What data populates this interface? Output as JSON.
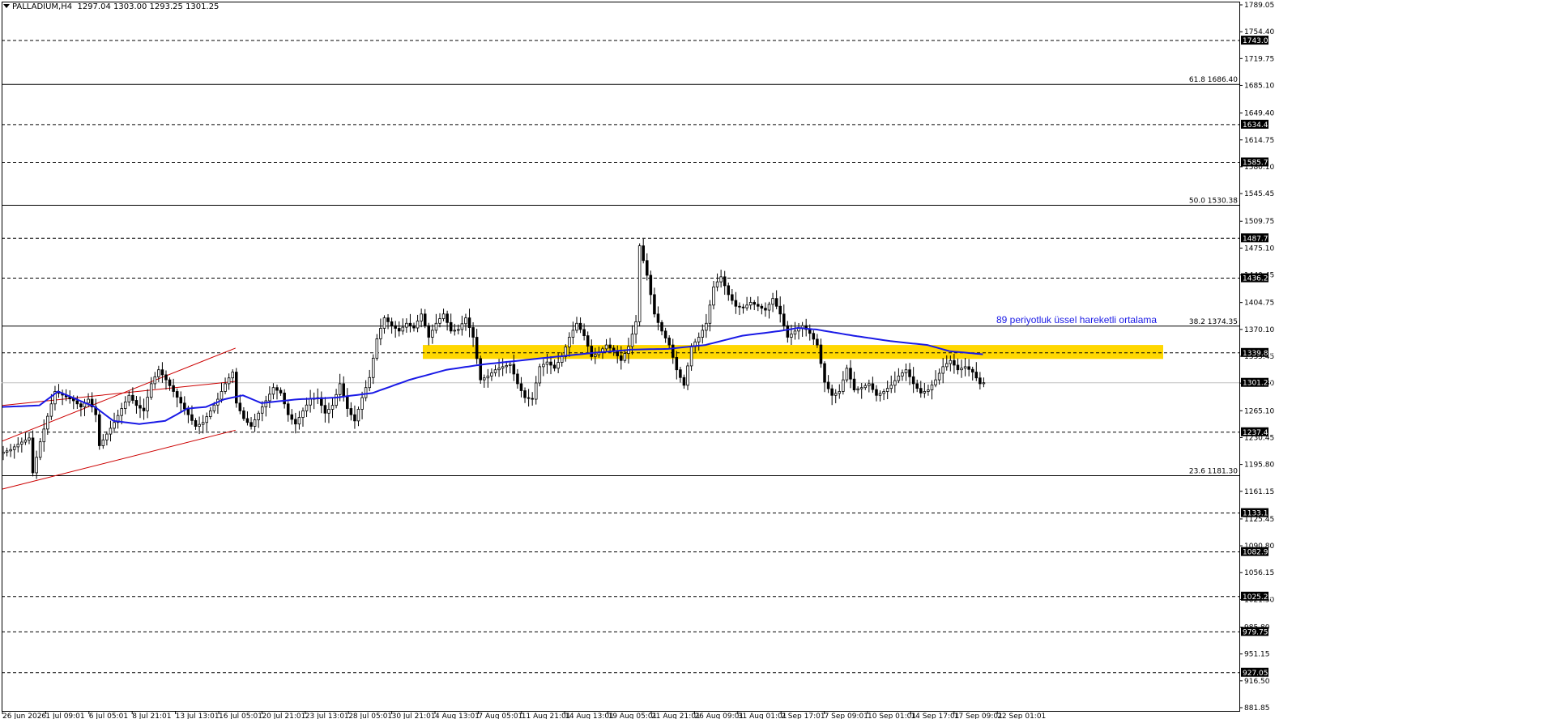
{
  "header": {
    "symbol": "PALLADIUM,H4",
    "ohlc": "1297.04 1303.00 1293.25 1301.25"
  },
  "annotation": "89 periyotluk üssel hareketli ortalama",
  "colors": {
    "candle": "#000000",
    "ema": "#1a1ae6",
    "channel": "#cc0000",
    "zone": "#ffd700",
    "grid": "#000000"
  },
  "chart_data": {
    "type": "candlestick",
    "symbol": "PALLADIUM",
    "timeframe": "H4",
    "ylim": [
      881.85,
      1789.05
    ],
    "y_ticks": [
      "1789.05",
      "1754.40",
      "1719.75",
      "1685.10",
      "1649.40",
      "1614.75",
      "1580.10",
      "1545.45",
      "1509.75",
      "1475.10",
      "1440.45",
      "1404.75",
      "1370.10",
      "1335.45",
      "1300.80",
      "1265.10",
      "1230.45",
      "1195.80",
      "1161.15",
      "1125.45",
      "1090.80",
      "1056.15",
      "1021.50",
      "985.80",
      "951.15",
      "916.50",
      "881.85"
    ],
    "x_ticks": [
      "26 Jun 2026",
      "1 Jul 09:01",
      "6 Jul 05:01",
      "8 Jul 21:01",
      "13 Jul 13:01",
      "16 Jul 05:01",
      "20 Jul 21:01",
      "23 Jul 13:01",
      "28 Jul 05:01",
      "30 Jul 21:01",
      "4 Aug 13:01",
      "7 Aug 05:01",
      "11 Aug 21:01",
      "14 Aug 13:01",
      "19 Aug 05:01",
      "21 Aug 21:01",
      "26 Aug 09:01",
      "31 Aug 01:01",
      "2 Sep 17:01",
      "7 Sep 09:01",
      "10 Sep 01:01",
      "14 Sep 17:01",
      "17 Sep 09:01",
      "22 Sep 01:01"
    ],
    "dashed_levels": [
      {
        "value": 1743.0,
        "label": "1743.00"
      },
      {
        "value": 1634.45,
        "label": "1634.45"
      },
      {
        "value": 1585.75,
        "label": "1585.75"
      },
      {
        "value": 1487.75,
        "label": "1487.75"
      },
      {
        "value": 1436.25,
        "label": "1436.25"
      },
      {
        "value": 1339.85,
        "label": "1339.85"
      },
      {
        "value": 1237.45,
        "label": "1237.45"
      },
      {
        "value": 1133.1,
        "label": "1133.10"
      },
      {
        "value": 1082.9,
        "label": "1082.90"
      },
      {
        "value": 1025.25,
        "label": "1025.25"
      },
      {
        "value": 979.75,
        "label": "979.75"
      },
      {
        "value": 927.05,
        "label": "927.05"
      }
    ],
    "fib_levels": [
      {
        "value": 1686.4,
        "label": "61.8 1686.40"
      },
      {
        "value": 1530.38,
        "label": "50.0 1530.38"
      },
      {
        "value": 1374.35,
        "label": "38.2 1374.35"
      },
      {
        "value": 1181.3,
        "label": "23.6 1181.30"
      }
    ],
    "current_price": {
      "value": 1301.25,
      "label": "1301.25"
    },
    "zone": {
      "top": 1350,
      "bottom": 1332
    },
    "price_path": [
      [
        0,
        1210
      ],
      [
        3,
        1215
      ],
      [
        5,
        1222
      ],
      [
        8,
        1230
      ],
      [
        9,
        1185
      ],
      [
        11,
        1225
      ],
      [
        13,
        1258
      ],
      [
        15,
        1290
      ],
      [
        18,
        1283
      ],
      [
        20,
        1278
      ],
      [
        22,
        1270
      ],
      [
        24,
        1280
      ],
      [
        26,
        1260
      ],
      [
        27,
        1220
      ],
      [
        29,
        1235
      ],
      [
        31,
        1250
      ],
      [
        33,
        1268
      ],
      [
        35,
        1285
      ],
      [
        37,
        1272
      ],
      [
        39,
        1265
      ],
      [
        41,
        1300
      ],
      [
        43,
        1318
      ],
      [
        45,
        1305
      ],
      [
        47,
        1290
      ],
      [
        49,
        1275
      ],
      [
        51,
        1260
      ],
      [
        53,
        1245
      ],
      [
        55,
        1250
      ],
      [
        57,
        1265
      ],
      [
        59,
        1280
      ],
      [
        61,
        1300
      ],
      [
        63,
        1315
      ],
      [
        64,
        1275
      ],
      [
        66,
        1255
      ],
      [
        68,
        1245
      ],
      [
        70,
        1262
      ],
      [
        72,
        1278
      ],
      [
        74,
        1295
      ],
      [
        76,
        1288
      ],
      [
        78,
        1260
      ],
      [
        80,
        1248
      ],
      [
        82,
        1265
      ],
      [
        84,
        1280
      ],
      [
        86,
        1282
      ],
      [
        88,
        1262
      ],
      [
        90,
        1272
      ],
      [
        92,
        1300
      ],
      [
        94,
        1268
      ],
      [
        96,
        1252
      ],
      [
        98,
        1282
      ],
      [
        100,
        1308
      ],
      [
        102,
        1358
      ],
      [
        104,
        1385
      ],
      [
        106,
        1375
      ],
      [
        108,
        1368
      ],
      [
        110,
        1378
      ],
      [
        112,
        1372
      ],
      [
        114,
        1390
      ],
      [
        116,
        1360
      ],
      [
        118,
        1378
      ],
      [
        120,
        1390
      ],
      [
        122,
        1368
      ],
      [
        124,
        1370
      ],
      [
        126,
        1385
      ],
      [
        128,
        1360
      ],
      [
        130,
        1305
      ],
      [
        132,
        1310
      ],
      [
        134,
        1318
      ],
      [
        136,
        1322
      ],
      [
        138,
        1325
      ],
      [
        140,
        1300
      ],
      [
        142,
        1282
      ],
      [
        144,
        1280
      ],
      [
        146,
        1322
      ],
      [
        148,
        1328
      ],
      [
        150,
        1320
      ],
      [
        152,
        1335
      ],
      [
        154,
        1360
      ],
      [
        156,
        1378
      ],
      [
        158,
        1362
      ],
      [
        160,
        1335
      ],
      [
        162,
        1340
      ],
      [
        164,
        1350
      ],
      [
        166,
        1342
      ],
      [
        168,
        1330
      ],
      [
        170,
        1348
      ],
      [
        172,
        1380
      ],
      [
        173,
        1478
      ],
      [
        175,
        1440
      ],
      [
        177,
        1390
      ],
      [
        179,
        1368
      ],
      [
        181,
        1350
      ],
      [
        183,
        1318
      ],
      [
        185,
        1298
      ],
      [
        187,
        1348
      ],
      [
        189,
        1360
      ],
      [
        191,
        1378
      ],
      [
        193,
        1425
      ],
      [
        195,
        1438
      ],
      [
        197,
        1415
      ],
      [
        199,
        1400
      ],
      [
        201,
        1398
      ],
      [
        203,
        1405
      ],
      [
        205,
        1400
      ],
      [
        207,
        1395
      ],
      [
        209,
        1410
      ],
      [
        211,
        1390
      ],
      [
        213,
        1360
      ],
      [
        215,
        1368
      ],
      [
        217,
        1375
      ],
      [
        219,
        1365
      ],
      [
        221,
        1350
      ],
      [
        223,
        1302
      ],
      [
        225,
        1285
      ],
      [
        227,
        1290
      ],
      [
        229,
        1320
      ],
      [
        231,
        1292
      ],
      [
        233,
        1295
      ],
      [
        235,
        1300
      ],
      [
        237,
        1285
      ],
      [
        239,
        1290
      ],
      [
        241,
        1298
      ],
      [
        243,
        1310
      ],
      [
        245,
        1318
      ],
      [
        247,
        1300
      ],
      [
        249,
        1288
      ],
      [
        251,
        1292
      ],
      [
        253,
        1305
      ],
      [
        255,
        1322
      ],
      [
        257,
        1330
      ],
      [
        259,
        1318
      ],
      [
        261,
        1322
      ],
      [
        263,
        1315
      ],
      [
        265,
        1300
      ],
      [
        266,
        1301.25
      ]
    ],
    "ema_path": [
      [
        0,
        1270
      ],
      [
        10,
        1272
      ],
      [
        15,
        1290
      ],
      [
        25,
        1270
      ],
      [
        30,
        1252
      ],
      [
        37,
        1248
      ],
      [
        44,
        1252
      ],
      [
        50,
        1268
      ],
      [
        55,
        1270
      ],
      [
        60,
        1280
      ],
      [
        65,
        1285
      ],
      [
        70,
        1275
      ],
      [
        80,
        1280
      ],
      [
        90,
        1282
      ],
      [
        100,
        1288
      ],
      [
        110,
        1305
      ],
      [
        120,
        1318
      ],
      [
        130,
        1325
      ],
      [
        140,
        1330
      ],
      [
        150,
        1335
      ],
      [
        160,
        1340
      ],
      [
        170,
        1344
      ],
      [
        180,
        1345
      ],
      [
        190,
        1350
      ],
      [
        200,
        1362
      ],
      [
        210,
        1368
      ],
      [
        215,
        1372
      ],
      [
        220,
        1370
      ],
      [
        230,
        1362
      ],
      [
        240,
        1355
      ],
      [
        250,
        1350
      ],
      [
        256,
        1342
      ],
      [
        265,
        1338
      ]
    ],
    "channel_lines": [
      {
        "x1": 0,
        "y1": 1226,
        "x2": 63,
        "y2": 1346
      },
      {
        "x1": 0,
        "y1": 1272,
        "x2": 63,
        "y2": 1303
      },
      {
        "x1": 0,
        "y1": 1164,
        "x2": 63,
        "y2": 1240
      }
    ]
  }
}
